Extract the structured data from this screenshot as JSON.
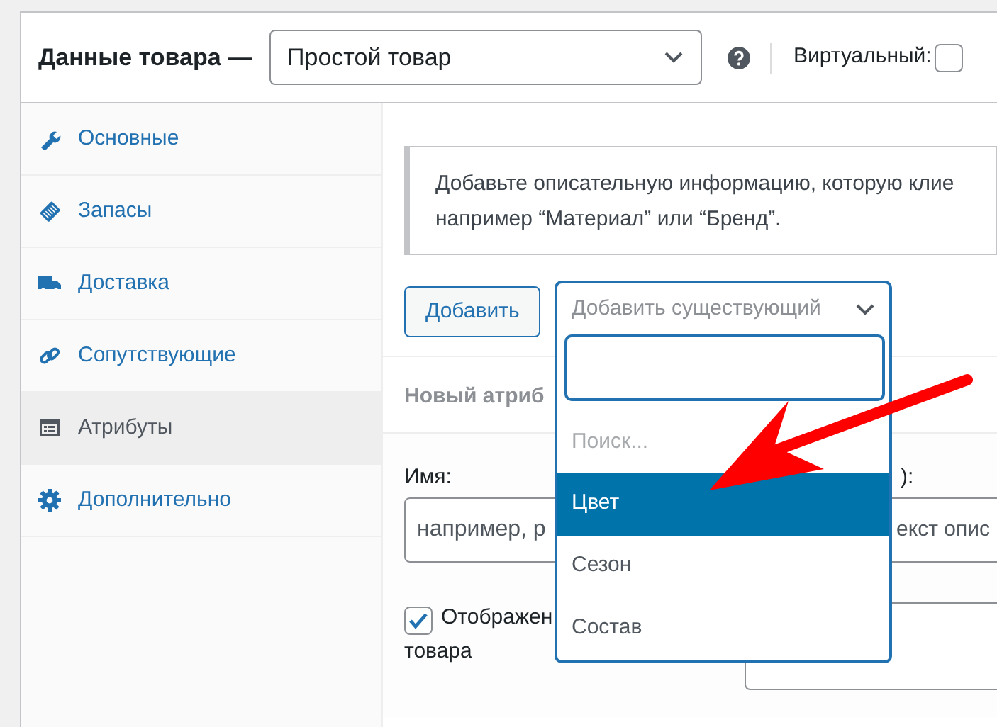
{
  "header": {
    "title": "Данные товара —",
    "product_type": "Простой товар",
    "virtual_label": "Виртуальный:",
    "virtual_checked": false
  },
  "tabs": [
    {
      "label": "Основные",
      "selected": false
    },
    {
      "label": "Запасы",
      "selected": false
    },
    {
      "label": "Доставка",
      "selected": false
    },
    {
      "label": "Сопутствующие",
      "selected": false
    },
    {
      "label": "Атрибуты",
      "selected": true
    },
    {
      "label": "Дополнительно",
      "selected": false
    }
  ],
  "notice": {
    "lines": [
      "Добавьте описательную информацию, которую клие",
      "например “Материал” или “Бренд”."
    ]
  },
  "add_button": "Добавить",
  "existing_select": {
    "placeholder": "Добавить существующий",
    "expanded": true,
    "search_hint": "Поиск...",
    "options": [
      {
        "label": "Цвет",
        "selected": true
      },
      {
        "label": "Сезон",
        "selected": false
      },
      {
        "label": "Состав",
        "selected": false
      }
    ]
  },
  "new_attribute": {
    "heading": "Новый атриб",
    "name_label": "Имя:",
    "name_placeholder": "например, р",
    "value_label": "):",
    "value_placeholder": "екст опис",
    "visible_checked": true,
    "visible_label_start": "Отображен",
    "visible_label_end": "товара"
  }
}
